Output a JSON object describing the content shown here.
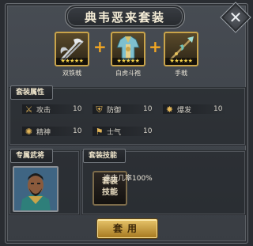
{
  "title": "典韦恶来套装",
  "items": [
    {
      "name": "双铁戟",
      "stars": "★★★★★",
      "icon": "double-halberd-icon"
    },
    {
      "name": "白虎斗袍",
      "stars": "★★★★★",
      "icon": "white-tiger-robe-icon"
    },
    {
      "name": "手戟",
      "stars": "★★★★★",
      "icon": "hand-halberd-icon"
    }
  ],
  "plus_sign": "+",
  "set_attributes": {
    "header": "套装属性",
    "stats": [
      {
        "label": "攻击",
        "value": "10",
        "icon": "crossed-swords-icon"
      },
      {
        "label": "防御",
        "value": "10",
        "icon": "shield-icon"
      },
      {
        "label": "爆发",
        "value": "10",
        "icon": "burst-icon"
      },
      {
        "label": "精神",
        "value": "10",
        "icon": "spirit-icon"
      },
      {
        "label": "士气",
        "value": "10",
        "icon": "morale-flag-icon"
      }
    ]
  },
  "exclusive_general": {
    "header": "专属武将",
    "portrait": "general-portrait"
  },
  "set_skill": {
    "header": "套装技能",
    "icon_text": "套装 技能",
    "description": "连击几率100%"
  },
  "equip_button": "套用",
  "colors": {
    "gold": "#c9a44a",
    "plus": "#f3a722",
    "button": "#d9b04e"
  }
}
